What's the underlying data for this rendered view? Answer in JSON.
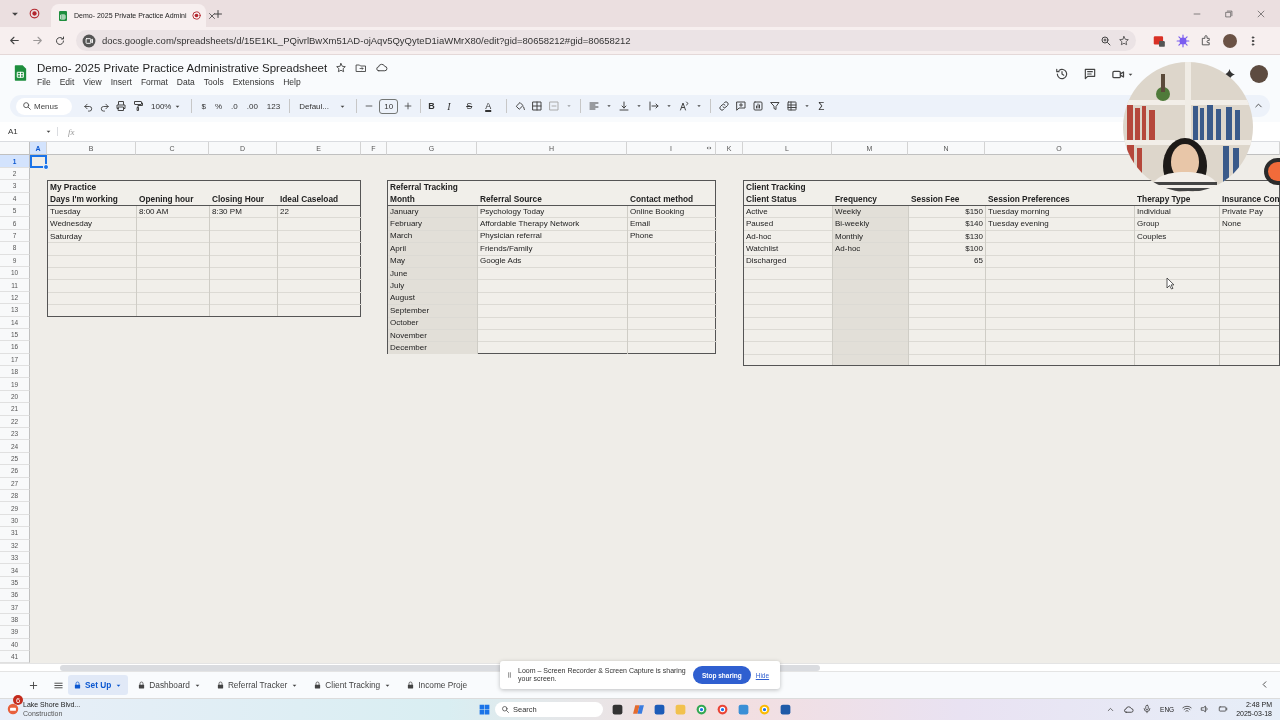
{
  "browser": {
    "tab_title": "Demo- 2025 Private Practice Admini",
    "url": "docs.google.com/spreadsheets/d/15E1KL_PQivrlBwXm51AD-ojAqv5QyQyteD1iaWMrX80/edit?gid=80658212#gid=80658212"
  },
  "document": {
    "title": "Demo- 2025 Private Practice Administrative Spreadsheet",
    "menus": [
      "File",
      "Edit",
      "View",
      "Insert",
      "Format",
      "Data",
      "Tools",
      "Extensions",
      "Help"
    ]
  },
  "toolbar": {
    "search": {
      "placeholder": "Menus"
    },
    "zoom": "100%",
    "number_formats": [
      "$",
      "%",
      ".0",
      ".00",
      "123"
    ],
    "font": "Defaul...",
    "font_size": "10",
    "text_styles": [
      {
        "kind": "bold",
        "label": "B"
      },
      {
        "kind": "italic",
        "label": "I"
      },
      {
        "kind": "strikethrough",
        "label": "S"
      },
      {
        "kind": "color",
        "label": "A"
      }
    ],
    "functions": "Σ"
  },
  "formula_bar": {
    "cell": "A1",
    "fx": "fx"
  },
  "columns": [
    {
      "label": "A",
      "selected": true
    },
    {
      "label": "B",
      "selected": false
    },
    {
      "label": "C",
      "selected": false
    },
    {
      "label": "D",
      "selected": false
    },
    {
      "label": "E",
      "selected": false
    },
    {
      "label": "F",
      "selected": false
    },
    {
      "label": "G",
      "selected": false
    },
    {
      "label": "H",
      "selected": false
    },
    {
      "label": "I",
      "selected": false
    },
    {
      "label": "K",
      "selected": false
    },
    {
      "label": "L",
      "selected": false
    },
    {
      "label": "M",
      "selected": false
    },
    {
      "label": "N",
      "selected": false
    },
    {
      "label": "O",
      "selected": false
    }
  ],
  "rows": [
    {
      "label": "1",
      "selected": true
    },
    {
      "label": "2",
      "selected": false
    },
    {
      "label": "3",
      "selected": false
    },
    {
      "label": "4",
      "selected": false
    },
    {
      "label": "5",
      "selected": false
    },
    {
      "label": "6",
      "selected": false
    },
    {
      "label": "7",
      "selected": false
    },
    {
      "label": "8",
      "selected": false
    },
    {
      "label": "9",
      "selected": false
    },
    {
      "label": "10",
      "selected": false
    },
    {
      "label": "11",
      "selected": false
    },
    {
      "label": "12",
      "selected": false
    },
    {
      "label": "13",
      "selected": false
    },
    {
      "label": "14",
      "selected": false
    },
    {
      "label": "15",
      "selected": false
    },
    {
      "label": "16",
      "selected": false
    },
    {
      "label": "17",
      "selected": false
    },
    {
      "label": "18",
      "selected": false
    },
    {
      "label": "19",
      "selected": false
    },
    {
      "label": "20",
      "selected": false
    },
    {
      "label": "21",
      "selected": false
    },
    {
      "label": "22",
      "selected": false
    },
    {
      "label": "23",
      "selected": false
    },
    {
      "label": "24",
      "selected": false
    },
    {
      "label": "25",
      "selected": false
    },
    {
      "label": "26",
      "selected": false
    },
    {
      "label": "27",
      "selected": false
    },
    {
      "label": "28",
      "selected": false
    },
    {
      "label": "29",
      "selected": false
    },
    {
      "label": "30",
      "selected": false
    },
    {
      "label": "31",
      "selected": false
    },
    {
      "label": "32",
      "selected": false
    },
    {
      "label": "33",
      "selected": false
    },
    {
      "label": "34",
      "selected": false
    },
    {
      "label": "35",
      "selected": false
    },
    {
      "label": "36",
      "selected": false
    },
    {
      "label": "37",
      "selected": false
    },
    {
      "label": "38",
      "selected": false
    },
    {
      "label": "39",
      "selected": false
    },
    {
      "label": "40",
      "selected": false
    },
    {
      "label": "41",
      "selected": false
    }
  ],
  "tables": [
    {
      "title": "My Practice",
      "columns": [
        {
          "header": "Days I'm working",
          "kind": "text",
          "shaded": false,
          "values": [
            "Tuesday",
            "Wednesday",
            "Saturday"
          ]
        },
        {
          "header": "Opening hour",
          "kind": "text",
          "shaded": false,
          "values": [
            "8:00 AM"
          ]
        },
        {
          "header": "Closing Hour",
          "kind": "text",
          "shaded": false,
          "values": [
            "8:30 PM"
          ]
        },
        {
          "header": "Ideal Caseload",
          "kind": "text",
          "shaded": false,
          "values": [
            "22"
          ]
        }
      ]
    },
    {
      "title": "Referral Tracking",
      "columns": [
        {
          "header": "Month",
          "kind": "text",
          "shaded": true,
          "values": [
            "January",
            "February",
            "March",
            "April",
            "May",
            "June",
            "July",
            "August",
            "September",
            "October",
            "November",
            "December"
          ]
        },
        {
          "header": "Referral Source",
          "kind": "text",
          "shaded": false,
          "values": [
            "Psychology Today",
            "Affordable Therapy Network",
            "Physician referral",
            "Friends/Family",
            "Google Ads"
          ]
        },
        {
          "header": "Contact method",
          "kind": "text",
          "shaded": false,
          "values": [
            "Online Booking",
            "Email",
            "Phone"
          ]
        }
      ]
    },
    {
      "title": "Client Tracking",
      "columns": [
        {
          "header": "Client Status",
          "kind": "text",
          "shaded": false,
          "values": [
            "Active",
            "Paused",
            "Ad-hoc",
            "Watchlist",
            "Discharged"
          ]
        },
        {
          "header": "Frequency",
          "kind": "text",
          "shaded": true,
          "values": [
            "Weekly",
            "Bi-weekly",
            "Monthly",
            "Ad-hoc"
          ]
        },
        {
          "header": "Session Fee",
          "kind": "amount",
          "shaded": false,
          "values": [
            "$150",
            "$140",
            "$130",
            "$100",
            "65"
          ]
        },
        {
          "header": "Session Preferences",
          "kind": "text",
          "shaded": false,
          "values": [
            "Tuesday morning",
            "Tuesday evening"
          ]
        },
        {
          "header": "Therapy Type",
          "kind": "text",
          "shaded": false,
          "values": [
            "Individual",
            "Group",
            "Couples"
          ]
        },
        {
          "header": "Insurance Con",
          "kind": "text",
          "shaded": false,
          "values": [
            "Private Pay",
            "None"
          ]
        }
      ]
    }
  ],
  "sheet_tabs": [
    {
      "label": "Set Up",
      "selected": true
    },
    {
      "label": "Dashboard",
      "selected": false
    },
    {
      "label": "Referral Tracker",
      "selected": false
    },
    {
      "label": "Client Tracking",
      "selected": false
    },
    {
      "label": "Income Proje",
      "selected": false
    }
  ],
  "loom": {
    "message": "Loom – Screen Recorder & Screen Capture is sharing your screen.",
    "stop_button": "Stop sharing",
    "hide_link": "Hide"
  },
  "taskbar": {
    "weather": {
      "badge": "6",
      "title": "Lake Shore Blvd...",
      "subtitle": "Construction"
    },
    "search": {
      "placeholder": "Search"
    },
    "language": "ENG",
    "time": "2:48 PM",
    "date": "2025-03-18"
  }
}
